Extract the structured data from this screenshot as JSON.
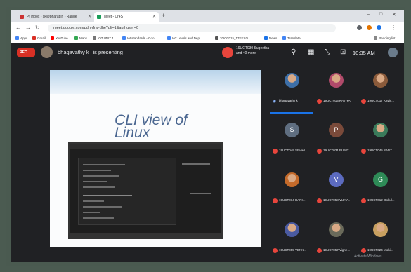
{
  "browser": {
    "tabs": [
      {
        "label": "Pt Inbox - sk@bharat.in - Range"
      },
      {
        "label": "Meet - Cr4S"
      }
    ],
    "address": "meet.google.com/pdh-rfrw-dhe?pli=1&authuser=0",
    "bookmarks": [
      "Apps",
      "Gmail",
      "YouTube",
      "Maps",
      "IOT UNIT 1",
      "Iot standards - Goo",
      "IoT Levels and Depl...",
      "20IOT015_17EEXO...",
      "News",
      "Translate"
    ],
    "reading_list": "Reading list"
  },
  "meet": {
    "rec_label": "REC",
    "presenting_text": "bhagavathy k j is presenting",
    "raised_text_line1": "19UCT030 Sugeetha",
    "raised_text_line2": "and 40 more",
    "clock": "10:35 AM"
  },
  "slide": {
    "title_line1": "CLI view of",
    "title_line2": "Linux"
  },
  "participants": [
    {
      "name": "bhagavathy k j",
      "active": true,
      "kind": "photo",
      "color": "#3d6fa8"
    },
    {
      "name": "19UCT015 KAVIYA",
      "kind": "photo",
      "color": "#b04a6a"
    },
    {
      "name": "19UCT017 Kavin...",
      "kind": "photo",
      "color": "#8a5a3a"
    },
    {
      "name": "19UCT049 Shivad...",
      "kind": "initial",
      "initial": "S",
      "color": "#5f6e80"
    },
    {
      "name": "19UCT031 PUNIT...",
      "kind": "initial",
      "initial": "P",
      "color": "#7a4a3a"
    },
    {
      "name": "19UCT045 SANT...",
      "kind": "photo",
      "color": "#3a7a5a"
    },
    {
      "name": "19UCT014 HARI...",
      "kind": "photo",
      "color": "#c46a2a"
    },
    {
      "name": "19UCT058 VIJAY...",
      "kind": "initial",
      "initial": "V",
      "color": "#5c6bc0"
    },
    {
      "name": "19UCT012 Gokul...",
      "kind": "initial",
      "initial": "G",
      "color": "#2e8b57"
    },
    {
      "name": "19UCT055 VENK...",
      "kind": "photo",
      "color": "#4a5aa0"
    },
    {
      "name": "19UCT057 Vigne...",
      "kind": "photo",
      "color": "#6a6a5a"
    },
    {
      "name": "19UCT024 Mohi...",
      "kind": "photo",
      "color": "#c8a060"
    }
  ],
  "watermark": "Activate Windows"
}
